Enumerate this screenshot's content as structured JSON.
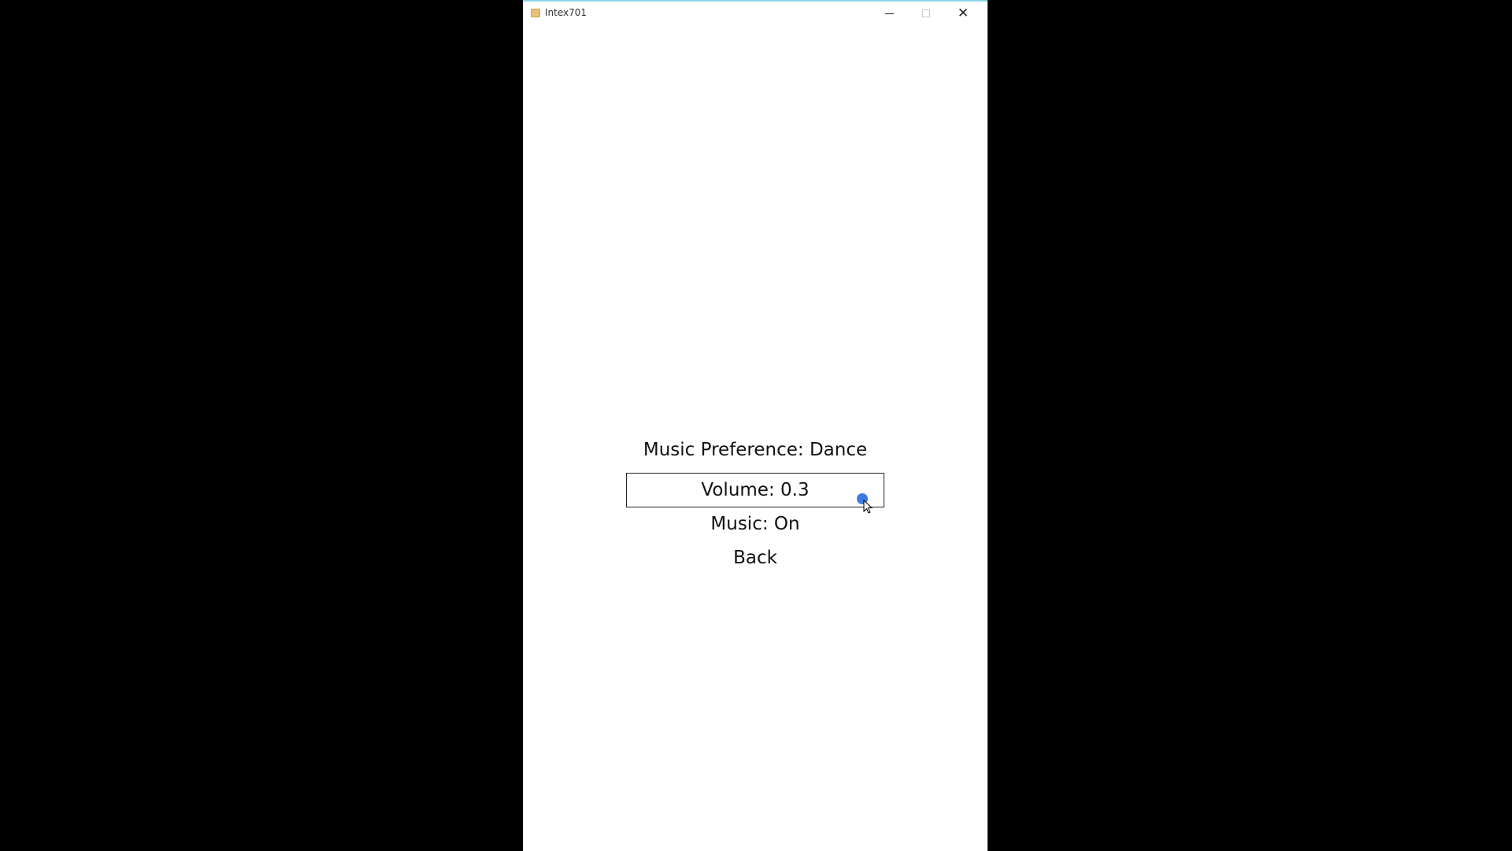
{
  "window": {
    "title": "Intex701",
    "controls": {
      "minimize_icon": "minimize-icon",
      "maximize_icon": "maximize-icon",
      "close_icon": "close-icon",
      "close_glyph": "✕"
    }
  },
  "menu": {
    "music_preference": "Music Preference: Dance",
    "volume": "Volume: 0.3",
    "music": "Music: On",
    "back": "Back"
  },
  "colors": {
    "background": "#000000",
    "window": "#ffffff",
    "text": "#111111",
    "cursor": "#3d7be0",
    "title_border": "#8fd3e6"
  }
}
